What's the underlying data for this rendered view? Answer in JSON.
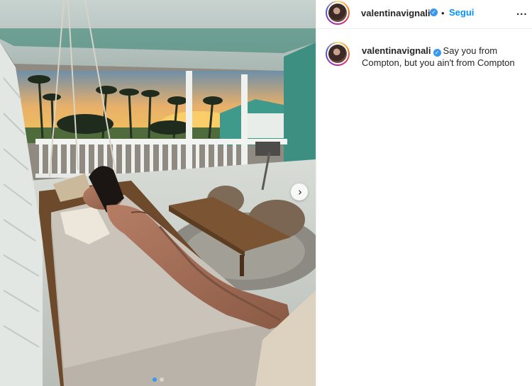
{
  "post": {
    "username": "valentinavignali",
    "verified": true,
    "separator": "•",
    "follow_label": "Segui",
    "more_label": "...",
    "caption_text": "Say you from Compton, but you ain't from Compton",
    "next_icon": "chevron-right-icon",
    "verified_icon": "verified-badge-icon"
  },
  "carousel": {
    "slides_total": 2,
    "active_slide": 1
  },
  "colors": {
    "accent": "#0095f6",
    "verified": "#3897f0",
    "text": "#262626",
    "border": "#efefef"
  }
}
